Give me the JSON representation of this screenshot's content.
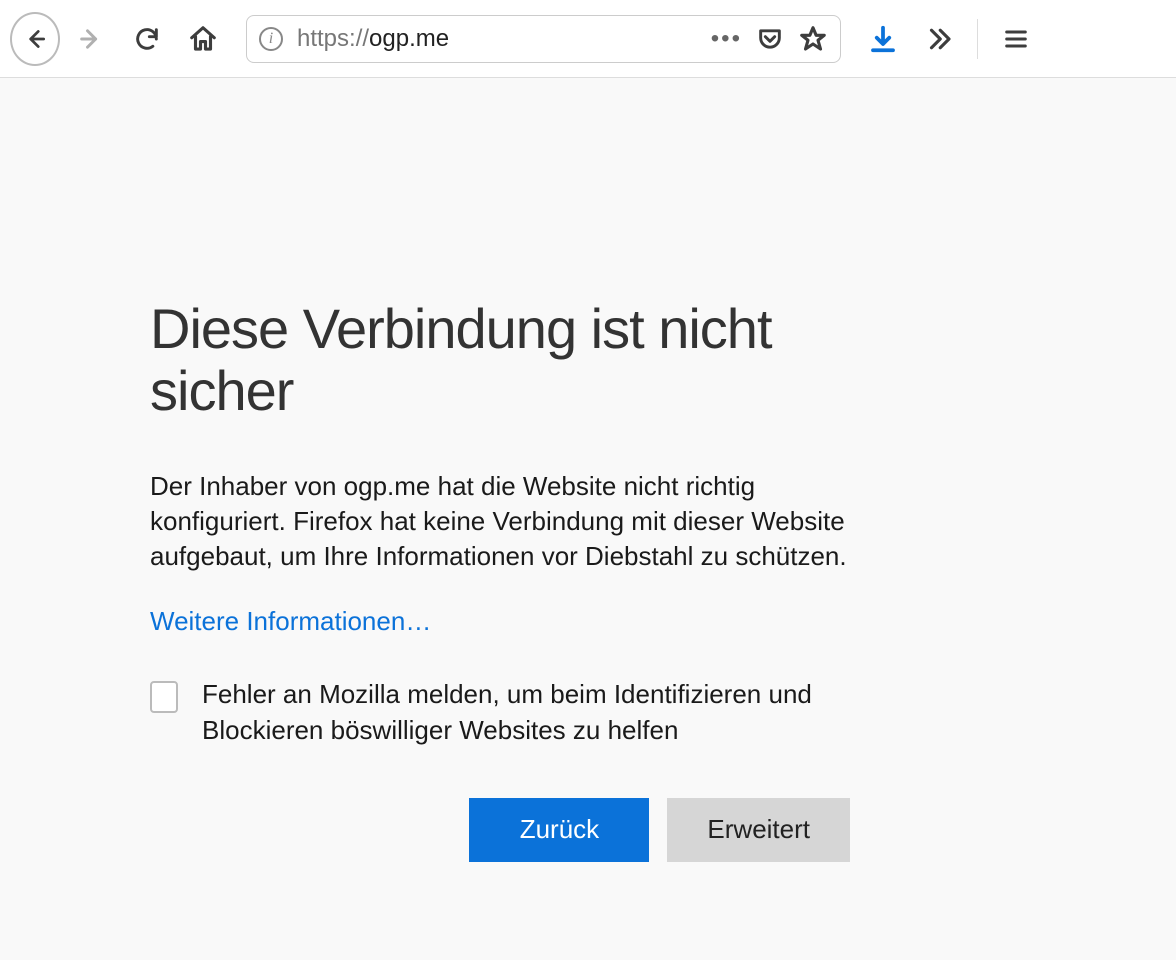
{
  "toolbar": {
    "url_prefix": "https://",
    "url_domain": "ogp.me"
  },
  "error": {
    "title": "Diese Verbindung ist nicht sicher",
    "description": "Der Inhaber von ogp.me hat die Website nicht richtig konfiguriert. Firefox hat keine Verbindung mit dieser Website aufgebaut, um Ihre Informationen vor Diebstahl zu schützen.",
    "more_info": "Weitere Informationen…",
    "checkbox_label": "Fehler an Mozilla melden, um beim Identifizieren und Blockieren böswilliger Websites zu helfen",
    "back_button": "Zurück",
    "advanced_button": "Erweitert"
  }
}
